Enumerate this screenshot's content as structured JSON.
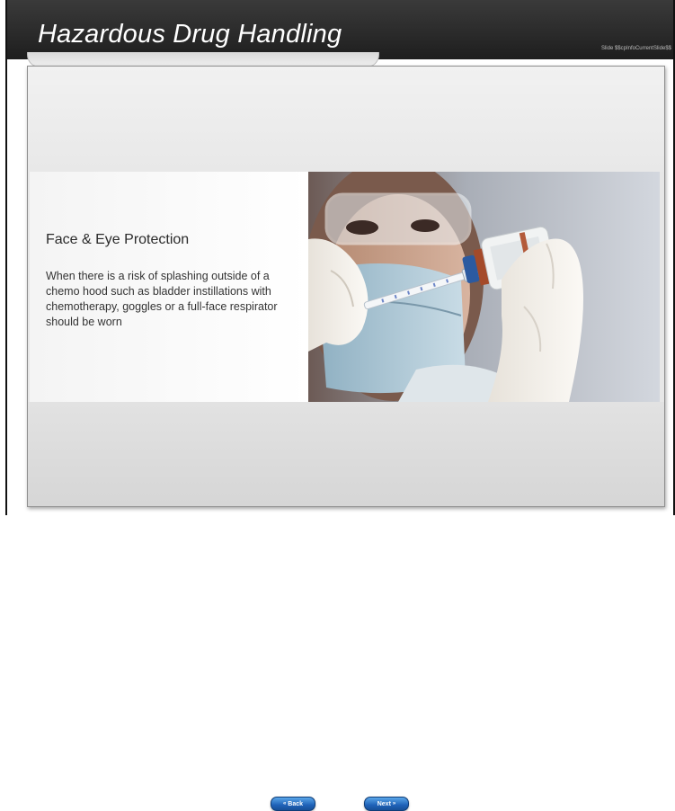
{
  "header": {
    "title": "Hazardous Drug Handling",
    "slide_info": "Slide $$cpInfoCurrentSlide$$"
  },
  "content": {
    "heading": "Face & Eye Protection",
    "body": "When there is a risk of splashing outside of a chemo hood such as bladder instillations with chemotherapy, goggles or a full-face respirator should be worn"
  },
  "nav": {
    "back_label": "Back",
    "back_icon": "double-chevron-left-icon",
    "next_label": "Next",
    "next_icon": "double-chevron-right-icon"
  },
  "colors": {
    "header_bg": "#2b2b2b",
    "panel_bg": "#e7e7e7",
    "button_blue": "#1f62b8"
  }
}
